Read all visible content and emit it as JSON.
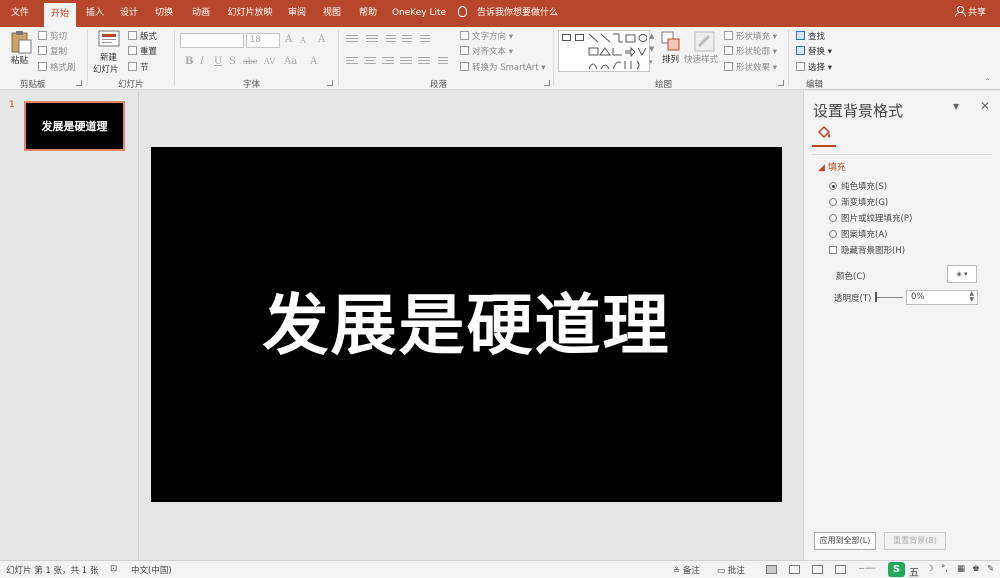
{
  "tabs": [
    {
      "label": "文件",
      "active": false
    },
    {
      "label": "开始",
      "active": true
    },
    {
      "label": "插入",
      "active": false
    },
    {
      "label": "设计",
      "active": false
    },
    {
      "label": "切换",
      "active": false
    },
    {
      "label": "动画",
      "active": false
    },
    {
      "label": "幻灯片放映",
      "active": false
    },
    {
      "label": "审阅",
      "active": false
    },
    {
      "label": "视图",
      "active": false
    },
    {
      "label": "帮助",
      "active": false
    },
    {
      "label": "OneKey Lite",
      "active": false
    }
  ],
  "tellme": "告诉我你想要做什么",
  "share": "共享",
  "ribbon": {
    "clipboard": {
      "label": "剪贴板",
      "paste": "粘贴",
      "cut": "剪切",
      "copy": "复制",
      "format_painter": "格式刷"
    },
    "slides": {
      "label": "幻灯片",
      "new_slide_line1": "新建",
      "new_slide_line2": "幻灯片",
      "layout": "版式",
      "reset": "重置",
      "section": "节"
    },
    "font": {
      "label": "字体",
      "font_name": "",
      "font_size": "18",
      "grow": "A",
      "shrink": "A",
      "clear": "A",
      "bold": "B",
      "italic": "I",
      "underline": "U",
      "shadow": "S",
      "strike": "abc",
      "spacing": "AV",
      "case": "Aa",
      "color": "A"
    },
    "paragraph": {
      "label": "段落",
      "text_direction": "文字方向",
      "align_text": "对齐文本",
      "convert_smartart": "转换为 SmartArt"
    },
    "drawing": {
      "label": "绘图",
      "arrange": "排列",
      "quick_styles": "快速样式",
      "shape_fill": "形状填充",
      "shape_outline": "形状轮廓",
      "shape_effects": "形状效果"
    },
    "editing": {
      "label": "编辑",
      "find": "查找",
      "replace": "替换",
      "select": "选择"
    }
  },
  "thumbnails": [
    {
      "number": "1",
      "text": "发展是硬道理"
    }
  ],
  "slide": {
    "title": "发展是硬道理"
  },
  "format_pane": {
    "title": "设置背景格式",
    "section": "填充",
    "options": [
      {
        "label": "纯色填充(S)",
        "type": "radio",
        "checked": true
      },
      {
        "label": "渐变填充(G)",
        "type": "radio",
        "checked": false
      },
      {
        "label": "图片或纹理填充(P)",
        "type": "radio",
        "checked": false
      },
      {
        "label": "图案填充(A)",
        "type": "radio",
        "checked": false
      },
      {
        "label": "隐藏背景图形(H)",
        "type": "checkbox",
        "checked": false
      }
    ],
    "color_label": "颜色(C)",
    "transparency_label": "透明度(T)",
    "transparency_value": "0%",
    "apply_all": "应用到全部(L)",
    "reset_background": "重置背景(B)"
  },
  "statusbar": {
    "slide_info": "幻灯片 第 1 张，共 1 张",
    "language": "中文(中国)",
    "notes": "备注",
    "comments": "批注",
    "ime": "五"
  },
  "colors": {
    "accent": "#b7472a",
    "slide_background": "#000000",
    "title_text": "#ffffff"
  }
}
